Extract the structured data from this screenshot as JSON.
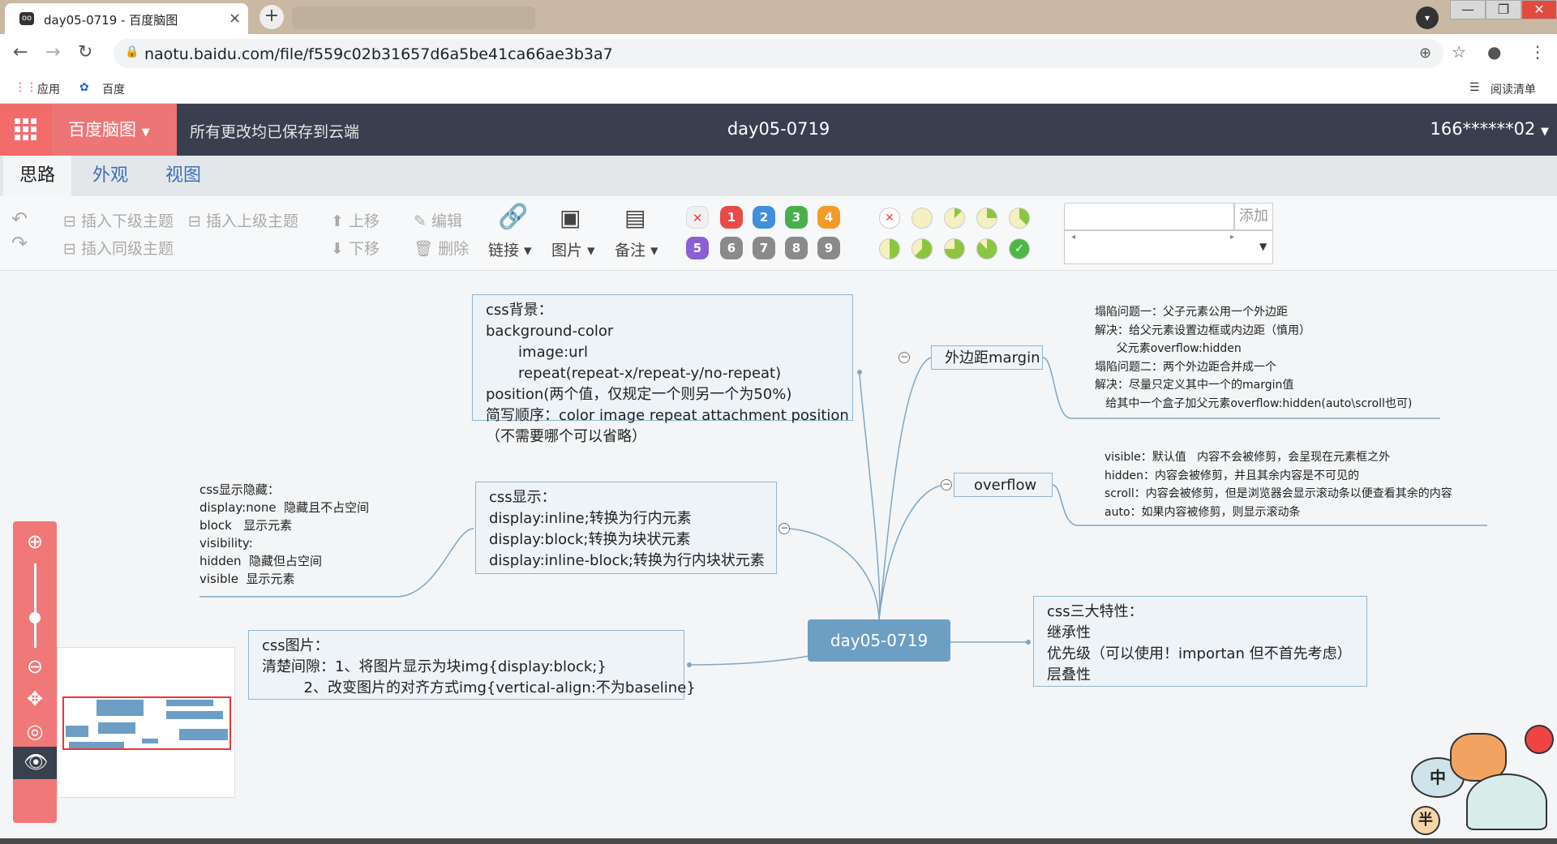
{
  "browser": {
    "tab_title": "day05-0719 - 百度脑图",
    "tab_close": "×",
    "new_tab": "+",
    "url": "naotu.baidu.com/file/f559c02b31657d6a5be41ca66ae3b3a7",
    "bookmarks": {
      "apps": "应用",
      "baidu": "百度",
      "reading_list": "阅读清单"
    }
  },
  "app": {
    "brand": "百度脑图",
    "save_status": "所有更改均已保存到云端",
    "doc_title": "day05-0719",
    "user": "166******02"
  },
  "menu_tabs": [
    "思路",
    "外观",
    "视图"
  ],
  "toolbar": {
    "insert_child": "插入下级主题",
    "insert_parent": "插入上级主题",
    "insert_sibling": "插入同级主题",
    "move_up": "上移",
    "move_down": "下移",
    "edit": "编辑",
    "delete": "删除",
    "link": "链接",
    "image": "图片",
    "note": "备注",
    "priorities": [
      "1",
      "2",
      "3",
      "4",
      "5",
      "6",
      "7",
      "8",
      "9"
    ],
    "add": "添加"
  },
  "colors": {
    "header_bg": "#393f4f",
    "brand_bg": "#ee7575",
    "node_border": "#8fb5cf",
    "root_bg": "#6d9ec4",
    "priority": [
      "#e84a4a",
      "#3f8fdc",
      "#48b04a",
      "#f39a2b",
      "#8b5fd6",
      "#8a8a8a",
      "#8a8a8a",
      "#8a8a8a",
      "#8a8a8a"
    ]
  },
  "mindmap": {
    "root": "day05-0719",
    "bg": "css背景：\nbackground-color\n       image:url\n       repeat(repeat-x/repeat-y/no-repeat)\nposition(两个值，仅规定一个则另一个为50%)\n简写顺序：color image repeat attachment position\n（不需要哪个可以省略）",
    "display": "css显示：\ndisplay:inline;转换为行内元素\ndisplay:block;转换为块状元素\ndisplay:inline-block;转换为行内块状元素",
    "display_note": "css显示隐藏：\ndisplay:none  隐藏且不占空间\nblock   显示元素\nvisibility:\nhidden  隐藏但占空间\nvisible  显示元素",
    "image": "css图片：\n清楚间隙：1、将图片显示为块img{display:block;}\n         2、改变图片的对齐方式img{vertical-align:不为baseline}",
    "margin": "外边距margin",
    "margin_note": "塌陷问题一：父子元素公用一个外边距\n解决：给父元素设置边框或内边距（慎用）\n      父元素overflow:hidden\n塌陷问题二：两个外边距合并成一个\n解决：尽量只定义其中一个的margin值\n   给其中一个盒子加父元素overflow:hidden(auto\\scroll也可)",
    "overflow": "overflow",
    "overflow_note": "visible：默认值   内容不会被修剪，会呈现在元素框之外\nhidden：内容会被修剪，并且其余内容是不可见的\nscroll：内容会被修剪，但是浏览器会显示滚动条以便查看其余的内容\nauto：如果内容被修剪，则显示滚动条",
    "traits": "css三大特性：\n继承性\n优先级（可以使用！importan 但不首先考虑）\n层叠性"
  },
  "mascot": {
    "zh": "中",
    "half": "半"
  }
}
